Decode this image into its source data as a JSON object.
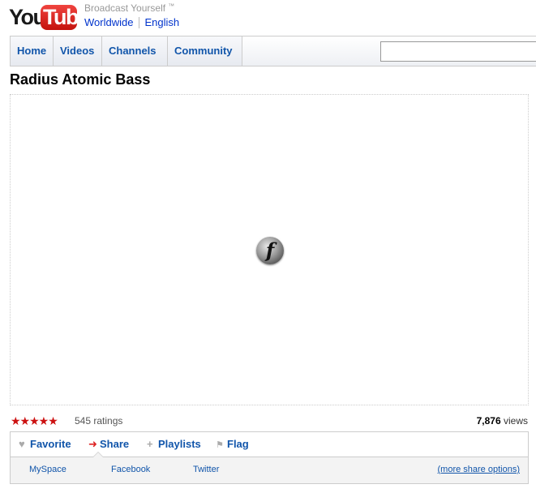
{
  "masthead": {
    "logo_you": "You",
    "logo_tube": "Tube",
    "tagline": "Broadcast Yourself",
    "trademark": "™",
    "region_link": "Worldwide",
    "language_link": "English"
  },
  "nav": {
    "tabs": [
      {
        "label": "Home"
      },
      {
        "label": "Videos"
      },
      {
        "label": "Channels"
      },
      {
        "label": "Community"
      }
    ],
    "search_value": ""
  },
  "video": {
    "title": "Radius Atomic Bass",
    "player_icon": "adobe-flash-icon",
    "player_icon_glyph": "f",
    "rating_stars": "★★★★★",
    "rating_count": "545 ratings",
    "view_count": "7,876",
    "view_label": " views"
  },
  "actions": {
    "favorite": {
      "icon": "heart-icon",
      "glyph": "♥",
      "label": "Favorite"
    },
    "share": {
      "icon": "arrow-right-icon",
      "glyph": "➜",
      "label": "Share"
    },
    "playlists": {
      "icon": "plus-icon",
      "glyph": "+",
      "label": "Playlists"
    },
    "flag": {
      "icon": "flag-icon",
      "glyph": "⚑",
      "label": "Flag"
    }
  },
  "share_panel": {
    "services": [
      {
        "label": "MySpace"
      },
      {
        "label": "Facebook"
      },
      {
        "label": "Twitter"
      }
    ],
    "more_link": "(more share options)"
  },
  "colors": {
    "link_blue": "#1155aa",
    "star_red": "#cc1111",
    "logo_red": "#e62117",
    "border_gray": "#cccccc"
  }
}
